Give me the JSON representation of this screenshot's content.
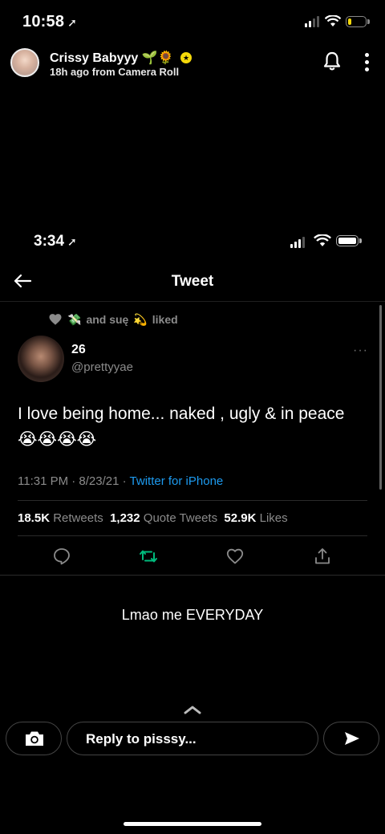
{
  "status_top": {
    "time": "10:58"
  },
  "snap": {
    "name": "Crissy Babyyy 🌱🌻",
    "subtitle": "18h ago from Camera Roll"
  },
  "inner_status": {
    "time": "3:34"
  },
  "tweet_screen": {
    "title": "Tweet",
    "liked_text": "and suę",
    "liked_suffix": "liked",
    "author_name": "26",
    "author_handle": "@prettyyae",
    "body": "I love being home... naked , ugly & in peace 😭😭😭😭",
    "timestamp": "11:31 PM · 8/23/21 · ",
    "source": "Twitter for iPhone",
    "retweets_count": "18.5K",
    "retweets_label": "Retweets",
    "quotes_count": "1,232",
    "quotes_label": "Quote Tweets",
    "likes_count": "52.9K",
    "likes_label": "Likes",
    "more_glyph": "···",
    "retweet_color": "#00ba7c",
    "link_color": "#1d9bf0"
  },
  "caption": "Lmao me EVERYDAY",
  "reply": {
    "placeholder": "Reply to pisssy..."
  },
  "icons": [
    "location-arrow-icon",
    "signal-icon",
    "wifi-icon",
    "battery-icon",
    "bell-icon",
    "more-vertical-icon",
    "back-arrow-icon",
    "heart-icon",
    "reply-icon",
    "retweet-icon",
    "like-icon",
    "share-icon",
    "chevron-up-icon",
    "camera-icon",
    "send-icon"
  ]
}
